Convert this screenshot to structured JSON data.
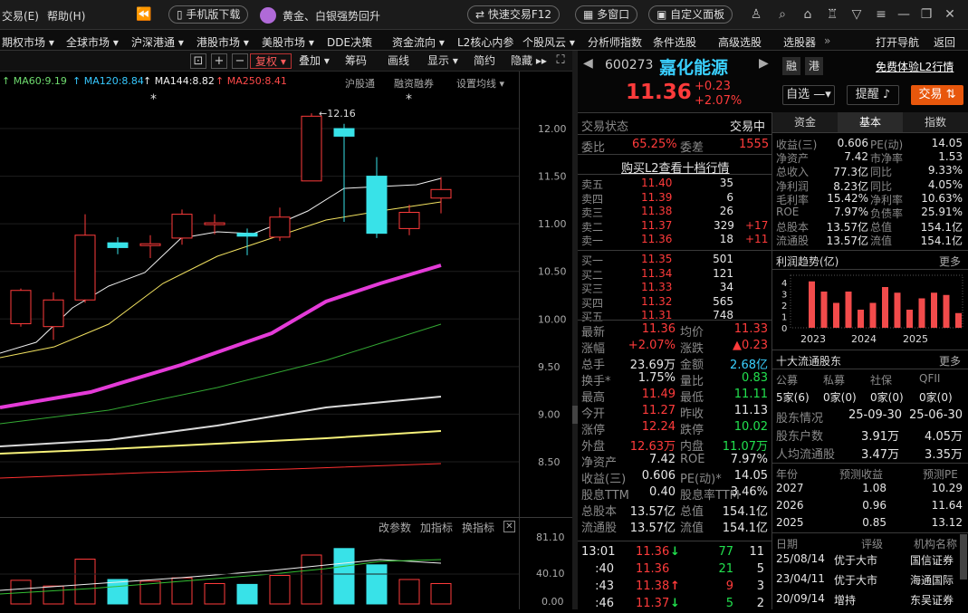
{
  "topbar": {
    "menu": [
      "交易(E)",
      "帮助(H)"
    ],
    "download": "手机版下载",
    "promo": "黄金、白银强势回升",
    "quick_trade": "快速交易F12",
    "multi_window": "多窗口",
    "custom_panel": "自定义面板"
  },
  "navbar": {
    "items": [
      "期权市场",
      "全球市场",
      "沪深港通",
      "港股市场",
      "美股市场",
      "DDE决策",
      "资金流向",
      "L2核心内参",
      "个股风云",
      "分析师指数",
      "条件选股",
      "高级选股",
      "选股器",
      "打开导航",
      "返回"
    ]
  },
  "chart_toolbar": {
    "restore": "复权",
    "overlay": "叠加",
    "chips": "筹码",
    "draw": "画线",
    "display": "显示",
    "simple": "简约",
    "hide": "隐藏"
  },
  "indicators": {
    "ma60": "MA60:9.19",
    "ma120": "MA120:8.84",
    "ma144": "MA144:8.82",
    "ma250": "MA250:8.41",
    "shgt": "沪股通",
    "margin": "融资融券",
    "settings": "设置均线"
  },
  "price_axis": [
    "12.00",
    "11.50",
    "11.00",
    "10.50",
    "10.00",
    "9.50",
    "9.00",
    "8.50"
  ],
  "high_mark": "12.16",
  "vol_panel": {
    "change_params": "改参数",
    "add_indicator": "加指标",
    "switch_indicator": "换指标",
    "axis": [
      "81.10",
      "40.10",
      "0.00"
    ]
  },
  "chart_data": {
    "type": "candlestick",
    "candles": [
      {
        "o": 9.95,
        "c": 10.3,
        "h": 10.32,
        "l": 9.92
      },
      {
        "o": 9.92,
        "c": 10.2,
        "h": 10.28,
        "l": 9.78
      },
      {
        "o": 10.2,
        "c": 10.88,
        "h": 11.1,
        "l": 10.17
      },
      {
        "o": 10.8,
        "c": 10.75,
        "h": 10.86,
        "l": 10.68
      },
      {
        "o": 10.78,
        "c": 10.79,
        "h": 10.88,
        "l": 10.64
      },
      {
        "o": 10.85,
        "c": 11.1,
        "h": 11.15,
        "l": 10.78
      },
      {
        "o": 11.0,
        "c": 11.01,
        "h": 11.1,
        "l": 10.89
      },
      {
        "o": 10.9,
        "c": 10.87,
        "h": 10.95,
        "l": 10.67
      },
      {
        "o": 10.86,
        "c": 11.07,
        "h": 11.17,
        "l": 10.82
      },
      {
        "o": 11.45,
        "c": 12.13,
        "h": 12.16,
        "l": 11.45
      },
      {
        "o": 12.0,
        "c": 11.92,
        "h": 12.05,
        "l": 11.02
      },
      {
        "o": 11.5,
        "c": 10.9,
        "h": 11.7,
        "l": 10.85
      },
      {
        "o": 10.95,
        "c": 11.12,
        "h": 11.2,
        "l": 10.88
      },
      {
        "o": 11.27,
        "c": 11.36,
        "h": 11.49,
        "l": 11.11
      }
    ],
    "volumes": [
      29,
      22,
      55,
      30,
      28,
      32,
      25,
      24,
      35,
      60,
      68,
      48,
      30,
      25
    ]
  },
  "stock": {
    "code": "600273",
    "name": "嘉化能源",
    "tag1": "融",
    "tag2": "港",
    "l2_trial": "免费体验L2行情",
    "price": "11.36",
    "change": "+0.23",
    "pct": "+2.07%",
    "btn_watch": "自选",
    "btn_alert": "提醒",
    "btn_trade": "交易"
  },
  "status": {
    "label": "交易状态",
    "value": "交易中",
    "wb_label": "委比",
    "wb": "65.25%",
    "wc_label": "委差",
    "wc": "1555",
    "l2_link": "购买L2查看十档行情"
  },
  "asks": [
    {
      "label": "卖五",
      "price": "11.40",
      "vol": "35",
      "chg": ""
    },
    {
      "label": "卖四",
      "price": "11.39",
      "vol": "6",
      "chg": ""
    },
    {
      "label": "卖三",
      "price": "11.38",
      "vol": "26",
      "chg": ""
    },
    {
      "label": "卖二",
      "price": "11.37",
      "vol": "329",
      "chg": "+17"
    },
    {
      "label": "卖一",
      "price": "11.36",
      "vol": "18",
      "chg": "+11"
    }
  ],
  "bids": [
    {
      "label": "买一",
      "price": "11.35",
      "vol": "501"
    },
    {
      "label": "买二",
      "price": "11.34",
      "vol": "121"
    },
    {
      "label": "买三",
      "price": "11.33",
      "vol": "34"
    },
    {
      "label": "买四",
      "price": "11.32",
      "vol": "565"
    },
    {
      "label": "买五",
      "price": "11.31",
      "vol": "748"
    }
  ],
  "quote": [
    {
      "l1": "最新",
      "v1": "11.36",
      "c1": "red",
      "l2": "均价",
      "v2": "11.33",
      "c2": "red"
    },
    {
      "l1": "涨幅",
      "v1": "+2.07%",
      "c1": "red",
      "l2": "涨跌",
      "v2": "▲0.23",
      "c2": "red"
    },
    {
      "l1": "总手",
      "v1": "23.69万",
      "c1": "wht",
      "l2": "金额",
      "v2": "2.68亿",
      "c2": "cyn"
    },
    {
      "l1": "换手*",
      "v1": "1.75%",
      "c1": "wht",
      "l2": "量比",
      "v2": "0.83",
      "c2": "grn"
    },
    {
      "l1": "最高",
      "v1": "11.49",
      "c1": "red",
      "l2": "最低",
      "v2": "11.11",
      "c2": "grn"
    },
    {
      "l1": "今开",
      "v1": "11.27",
      "c1": "red",
      "l2": "昨收",
      "v2": "11.13",
      "c2": "wht"
    },
    {
      "l1": "涨停",
      "v1": "12.24",
      "c1": "red",
      "l2": "跌停",
      "v2": "10.02",
      "c2": "grn"
    },
    {
      "l1": "外盘",
      "v1": "12.63万",
      "c1": "red",
      "l2": "内盘",
      "v2": "11.07万",
      "c2": "grn"
    },
    {
      "l1": "净资产",
      "v1": "7.42",
      "c1": "wht",
      "l2": "ROE",
      "v2": "7.97%",
      "c2": "wht"
    },
    {
      "l1": "收益(三)",
      "v1": "0.606",
      "c1": "wht",
      "l2": "PE(动)*",
      "v2": "14.05",
      "c2": "wht"
    },
    {
      "l1": "股息TTM",
      "v1": "0.40",
      "c1": "wht",
      "l2": "股息率TTM",
      "v2": "3.46%",
      "c2": "wht"
    },
    {
      "l1": "总股本",
      "v1": "13.57亿",
      "c1": "wht",
      "l2": "总值",
      "v2": "154.1亿",
      "c2": "wht"
    },
    {
      "l1": "流通股",
      "v1": "13.57亿",
      "c1": "wht",
      "l2": "流值",
      "v2": "154.1亿",
      "c2": "wht"
    }
  ],
  "ticks": [
    {
      "time": "13:01",
      "price": "11.36",
      "arrow": "↓",
      "vol": "77",
      "n": "11",
      "ac": "grn",
      "vc": "grn"
    },
    {
      "time": ":40",
      "price": "11.36",
      "arrow": "",
      "vol": "21",
      "n": "5",
      "ac": "grn",
      "vc": "grn"
    },
    {
      "time": ":43",
      "price": "11.38",
      "arrow": "↑",
      "vol": "9",
      "n": "3",
      "ac": "red",
      "vc": "red"
    },
    {
      "time": ":46",
      "price": "11.37",
      "arrow": "↓",
      "vol": "5",
      "n": "2",
      "ac": "grn",
      "vc": "grn"
    }
  ],
  "tabs": [
    "资金",
    "基本",
    "指数"
  ],
  "fundamentals": [
    {
      "l1": "收益(三)",
      "v1": "0.606",
      "l2": "PE(动)",
      "v2": "14.05"
    },
    {
      "l1": "净资产",
      "v1": "7.42",
      "l2": "市净率",
      "v2": "1.53"
    },
    {
      "l1": "总收入",
      "v1": "77.3亿",
      "l2": "同比",
      "v2": "9.33%"
    },
    {
      "l1": "净利润",
      "v1": "8.23亿",
      "l2": "同比",
      "v2": "4.05%"
    },
    {
      "l1": "毛利率",
      "v1": "15.42%",
      "l2": "净利率",
      "v2": "10.63%"
    },
    {
      "l1": "ROE",
      "v1": "7.97%",
      "l2": "负债率",
      "v2": "25.91%"
    },
    {
      "l1": "总股本",
      "v1": "13.57亿",
      "l2": "总值",
      "v2": "154.1亿"
    },
    {
      "l1": "流通股",
      "v1": "13.57亿",
      "l2": "流值",
      "v2": "154.1亿"
    }
  ],
  "profit": {
    "title": "利润趋势(亿)",
    "more": "更多",
    "yaxis": [
      "4",
      "3",
      "2",
      "1",
      "0"
    ],
    "years": [
      "2023",
      "2024",
      "2025"
    ],
    "bars": [
      4.1,
      3.2,
      2.2,
      3.2,
      1.6,
      2.2,
      3.6,
      3.1,
      1.6,
      2.6,
      3.1,
      2.9,
      1.3
    ]
  },
  "holders": {
    "title": "十大流通股东",
    "more": "更多",
    "cols": [
      "公募",
      "私募",
      "社保",
      "QFII"
    ],
    "vals": [
      "5家(6)",
      "0家(0)",
      "0家(0)",
      "0家(0)"
    ]
  },
  "shareholders": [
    {
      "l": "股东情况",
      "a": "25-09-30",
      "b": "25-06-30"
    },
    {
      "l": "股东户数",
      "a": "3.91万",
      "b": "4.05万"
    },
    {
      "l": "人均流通股",
      "a": "3.47万",
      "b": "3.35万"
    }
  ],
  "forecast": {
    "cols": [
      "年份",
      "预测收益",
      "预测PE"
    ],
    "rows": [
      [
        "2027",
        "1.08",
        "10.29"
      ],
      [
        "2026",
        "0.96",
        "11.64"
      ],
      [
        "2025",
        "0.85",
        "13.12"
      ]
    ]
  },
  "ratings": {
    "cols": [
      "日期",
      "评级",
      "机构名称"
    ],
    "rows": [
      [
        "25/08/14",
        "优于大市",
        "国信证券"
      ],
      [
        "23/04/11",
        "优于大市",
        "海通国际"
      ],
      [
        "20/09/14",
        "增持",
        "东吴证券"
      ]
    ]
  }
}
